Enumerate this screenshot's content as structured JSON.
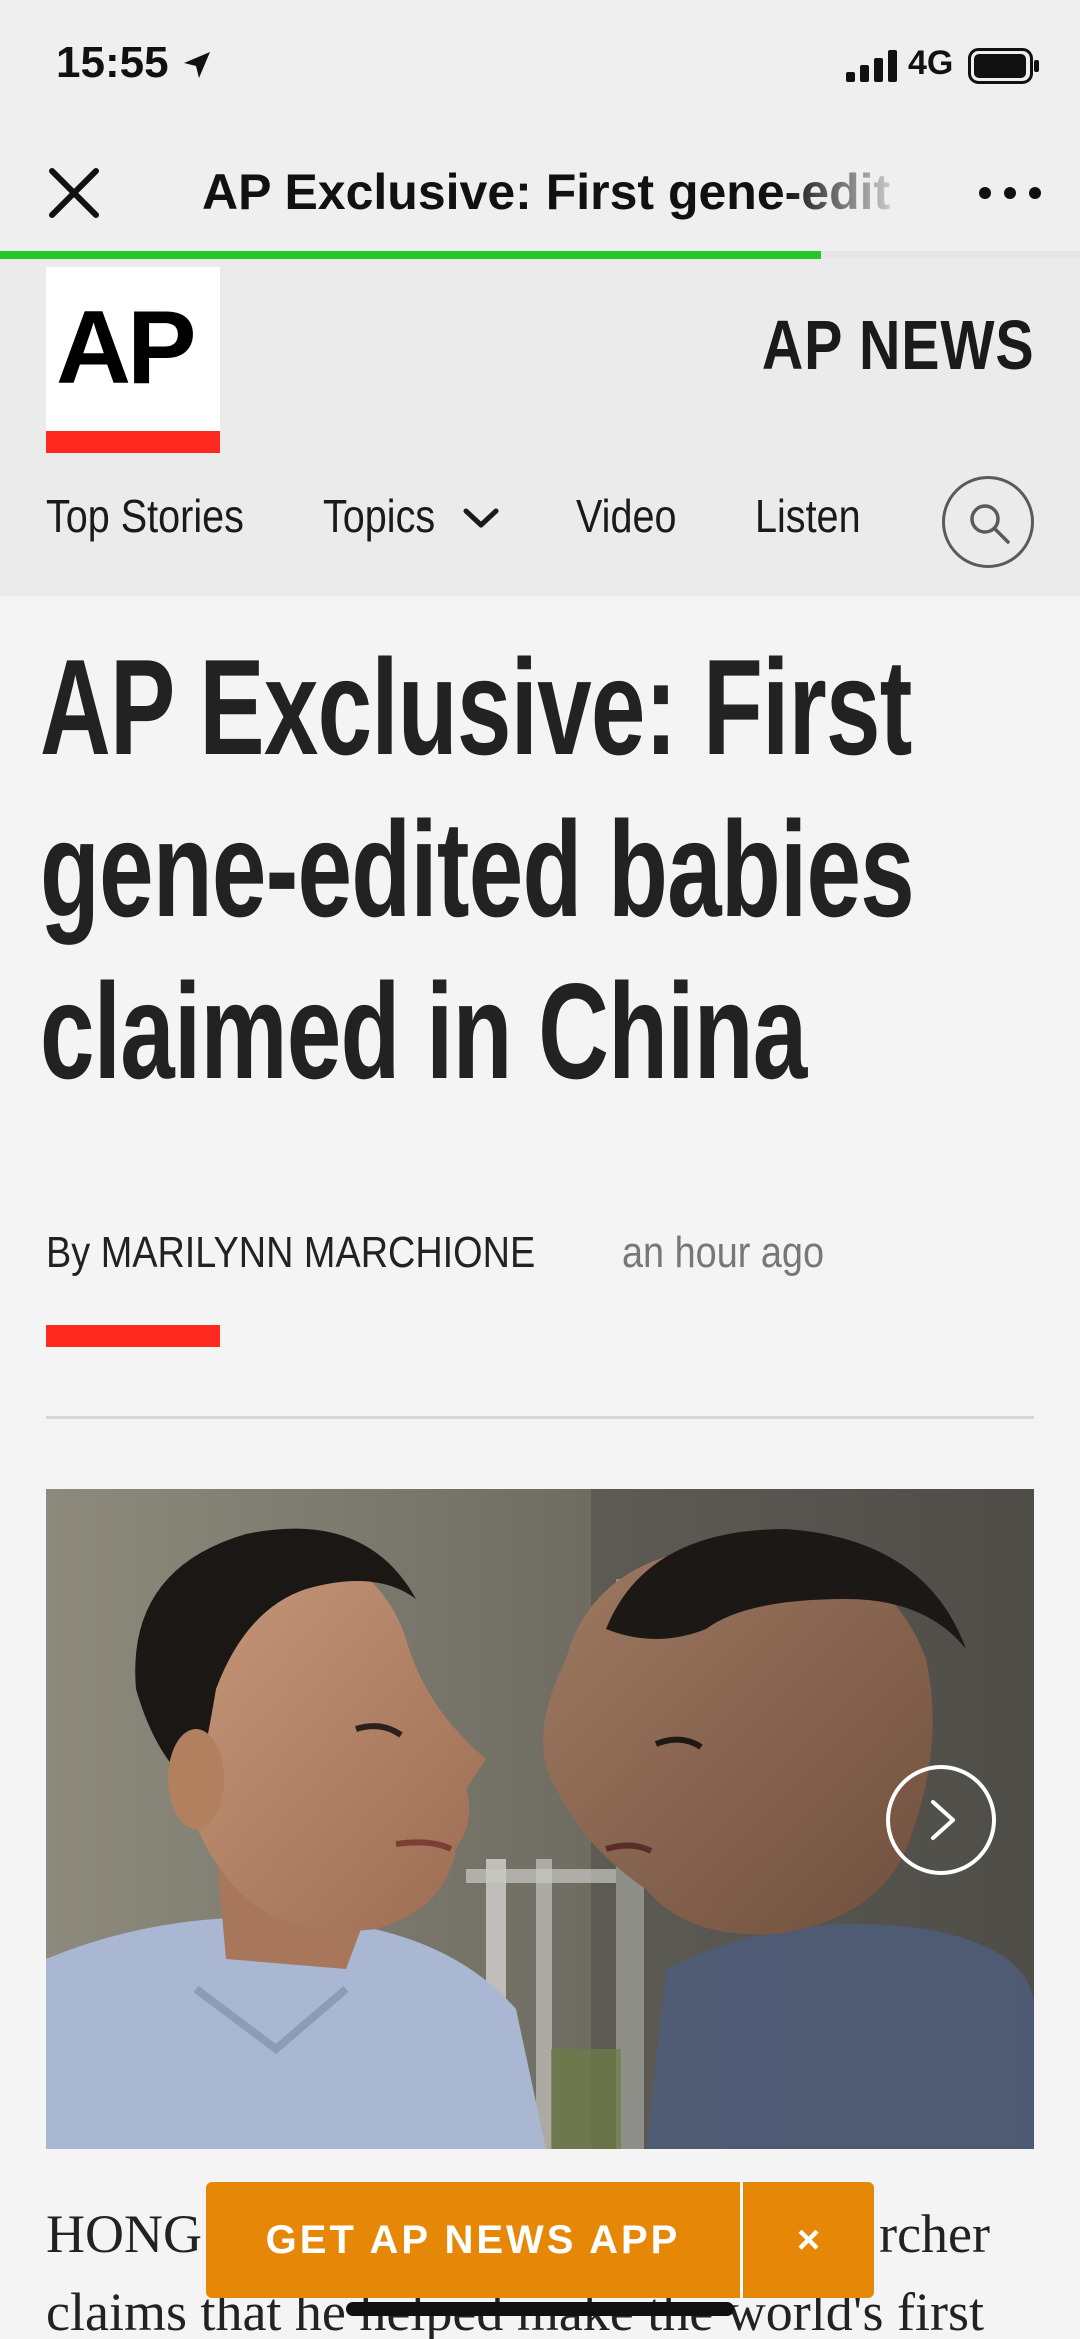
{
  "status_bar": {
    "time": "15:55",
    "network": "4G",
    "icons": [
      "location-arrow-icon",
      "signal-bars-icon",
      "battery-icon"
    ]
  },
  "browser": {
    "title": "AP Exclusive: First gene-edit",
    "close_icon": "close-icon",
    "more_icon": "more-dots-icon",
    "load_progress_percent": 76,
    "progress_color": "#26c62b"
  },
  "site": {
    "logo_text": "AP",
    "brand": "AP NEWS",
    "accent_color": "#ff2a1f",
    "nav": [
      {
        "label": "Top Stories"
      },
      {
        "label": "Topics"
      },
      {
        "label": "Video"
      },
      {
        "label": "Listen"
      }
    ],
    "search_icon": "search-icon"
  },
  "article": {
    "headline": "AP Exclusive: First gene-edited babies claimed in China",
    "byline_prefix": "By",
    "author": "MARILYNN MARCHIONE",
    "timestamp": "an hour ago",
    "body_line1_start": "HONG",
    "body_line1_end": "rcher",
    "body_line2": "claims that he helped make the world's first"
  },
  "app_banner": {
    "label": "GET AP NEWS APP",
    "close": "×",
    "color": "#e78707"
  }
}
